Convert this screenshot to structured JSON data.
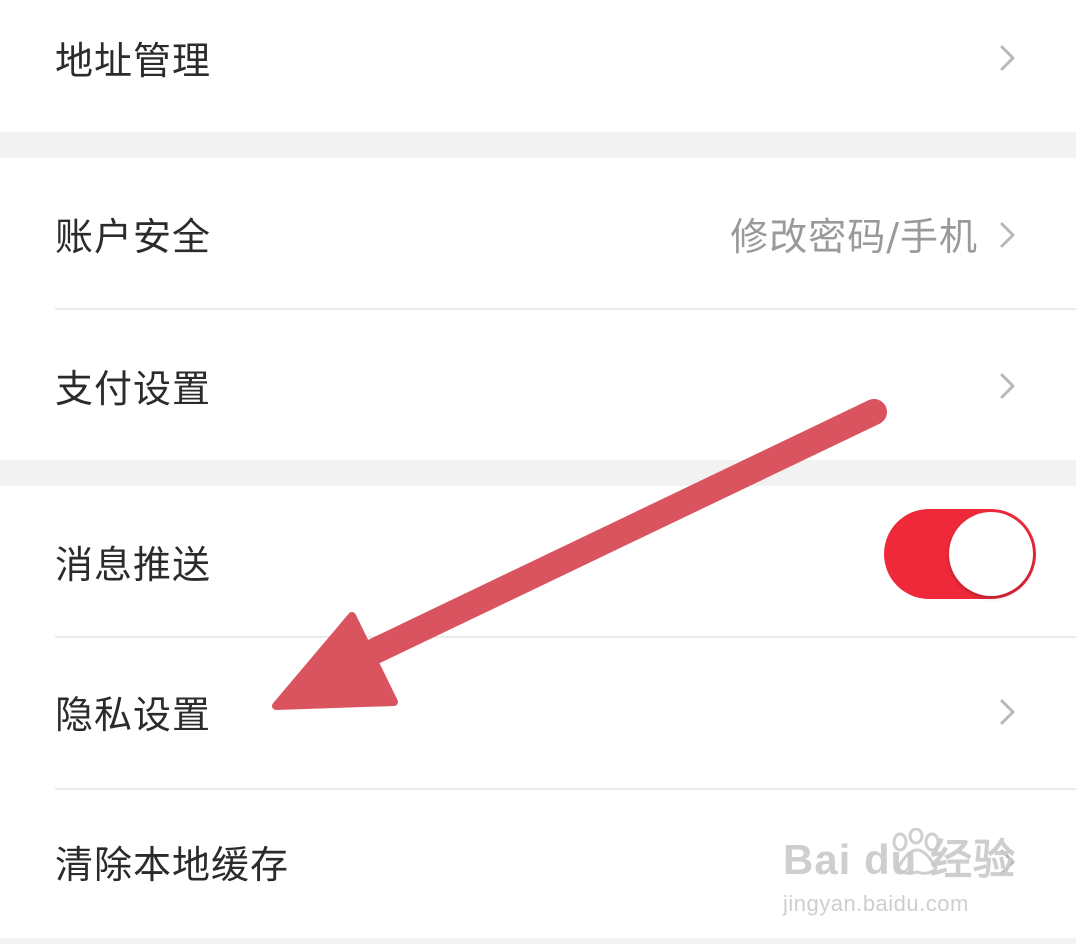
{
  "settings": {
    "address_management": "地址管理",
    "account_security": "账户安全",
    "account_security_value": "修改密码/手机",
    "payment_settings": "支付设置",
    "message_push": "消息推送",
    "message_push_enabled": true,
    "privacy_settings": "隐私设置",
    "clear_cache": "清除本地缓存"
  },
  "colors": {
    "toggle_on": "#f0293a",
    "annotation_arrow": "#d9545e",
    "section_gap": "#f2f2f2"
  },
  "watermark": {
    "brand": "Bai du 经验",
    "url": "jingyan.baidu.com"
  }
}
